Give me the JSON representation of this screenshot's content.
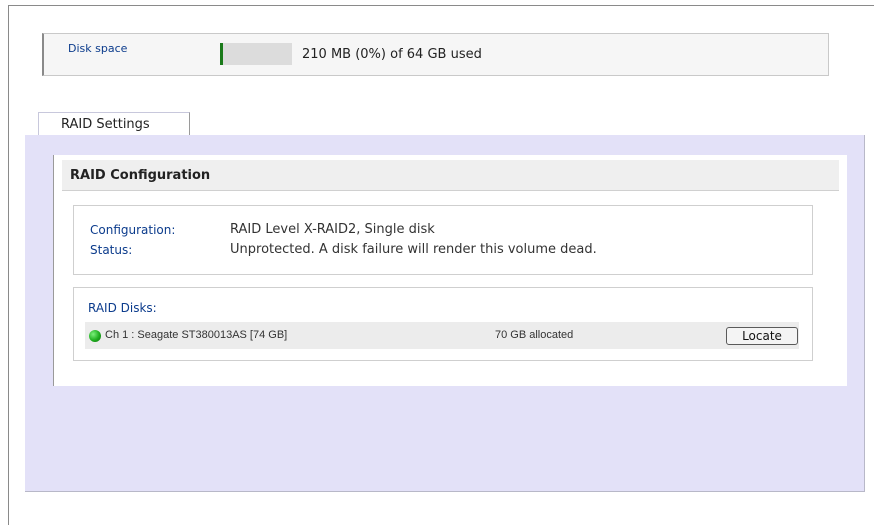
{
  "disk_space": {
    "label": "Disk space",
    "usage_text": "210 MB (0%) of 64 GB used",
    "used_fraction": 0.003
  },
  "tabs": [
    {
      "label": "RAID Settings",
      "active": true
    }
  ],
  "raid_configuration": {
    "title": "RAID Configuration",
    "configuration_label": "Configuration:",
    "configuration_value": "RAID Level X-RAID2, Single disk",
    "status_label": "Status:",
    "status_value": "Unprotected. A disk failure will render this volume dead."
  },
  "raid_disks": {
    "label": "RAID Disks:",
    "items": [
      {
        "name": "Ch 1 : Seagate ST380013AS [74 GB]",
        "allocated": "70 GB allocated",
        "status_color": "#1fae1f",
        "button_label": "Locate"
      }
    ]
  }
}
